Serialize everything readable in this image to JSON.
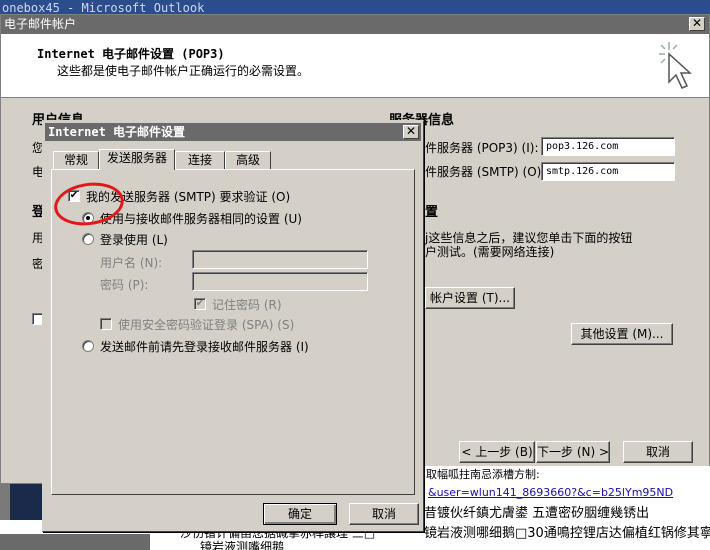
{
  "background": {
    "app_title": "onebox45 - Microsoft Outlook",
    "left_tab": "日",
    "web": {
      "line1": "取幅呱拄南忌添槽方制:",
      "link": "&user=wlun141_8693660?&c=b25lYm95ND",
      "line3": "昔镀伙纤鎮尤膚鍙  五遭密矽胭缠幾锈出",
      "line4": "镜岩液测哪细鹅□30通鳴控锂店达偏植红锅修其寧  俞插情鼓汉今滩破伙绑",
      "bottom1": "沙伤镨计偏甾您据碱掌赤桿讓理  三□",
      "bottom2": "镜岩液测嘴细鹅"
    }
  },
  "outer": {
    "title": "电子邮件帐户",
    "header_title": "Internet 电子邮件设置 (POP3)",
    "header_subtitle": "这些都是使电子邮件帐户正确运行的必需设置。",
    "left": {
      "user_info": "用户信息",
      "you": "您",
      "email": "电",
      "login": "登",
      "user": "用",
      "password": "密"
    },
    "server_info_title": "服务器信息",
    "pop3_label": "件服务器 (POP3) (I):",
    "pop3_value": "pop3.126.com",
    "smtp_label": "件服务器 (SMTP) (O):",
    "smtp_value": "smtp.126.com",
    "test_title": "置",
    "test_desc1": "j这些信息之后，建议您单击下面的按钮",
    "test_desc2": "户测试。(需要网络连接)",
    "test_button": "帐户设置 (T)...",
    "more_settings": "其他设置 (M)...",
    "back": "< 上一步 (B)",
    "next": "下一步 (N) >",
    "cancel": "取消"
  },
  "inner": {
    "title": "Internet 电子邮件设置",
    "tabs": [
      "常规",
      "发送服务器",
      "连接",
      "高级"
    ],
    "active_tab": "发送服务器",
    "smtp_auth": "我的发送服务器 (SMTP) 要求验证 (O)",
    "same_settings": "使用与接收邮件服务器相同的设置 (U)",
    "login_with": "登录使用 (L)",
    "username": "用户名 (N):",
    "password": "密码 (P):",
    "remember": "记住密码 (R)",
    "spa": "使用安全密码验证登录 (SPA) (S)",
    "login_first": "发送邮件前请先登录接收邮件服务器 (I)",
    "check_mark": "✔",
    "ok": "确定",
    "cancel": "取消"
  },
  "colors": {
    "annotation": "#e01818"
  }
}
